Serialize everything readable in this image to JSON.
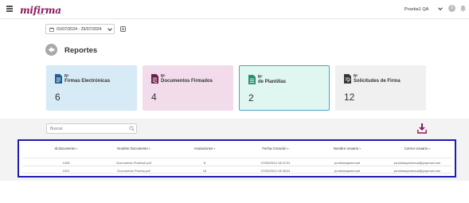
{
  "header": {
    "logo_text": "mifirma",
    "logo_sub": "e-firma",
    "user_name": "Prueba1 QA"
  },
  "filters": {
    "date_range": "01/07/2024 - 25/07/2024"
  },
  "page": {
    "title": "Reportes"
  },
  "cards": [
    {
      "line1": "Nº",
      "line2": "Firmas Electrónicas",
      "value": "6",
      "color": "#d7ebf6",
      "icon": "document-signature-icon"
    },
    {
      "line1": "Nº",
      "line2": "Documentos Firmados",
      "value": "4",
      "color": "#f2dceb",
      "icon": "signed-document-icon"
    },
    {
      "line1": "Nº",
      "line2": "de Plantillas",
      "value": "2",
      "color": "#dff6f1",
      "icon": "template-icon"
    },
    {
      "line1": "Nº",
      "line2": "Solicitudes de Firma",
      "value": "12",
      "color": "#f0f0f0",
      "icon": "signature-request-icon"
    }
  ],
  "search": {
    "placeholder": "Buscar"
  },
  "table": {
    "columns": [
      "Id documento",
      "Nombre Documento",
      "Anotaciones",
      "Fecha Creación",
      "Nombre Usuario",
      "Correo Usuario"
    ],
    "rows": [
      [
        "1028",
        "Documento Prueba2.pdf",
        "8",
        "07/05/2024 18:22:31",
        "pruebasqamenual",
        "pruebasqamenual@yopmail.com"
      ],
      [
        "1021",
        "Documento Prueba.pdf",
        "16",
        "07/05/2024 15:38:04",
        "pruebasqamenual",
        "pruebasqamenual@yopmail.com"
      ]
    ]
  },
  "colors": {
    "brand": "#8a1a5c",
    "accent_border": "#1f1bb5",
    "selected_card_border": "#4aa3c9"
  }
}
